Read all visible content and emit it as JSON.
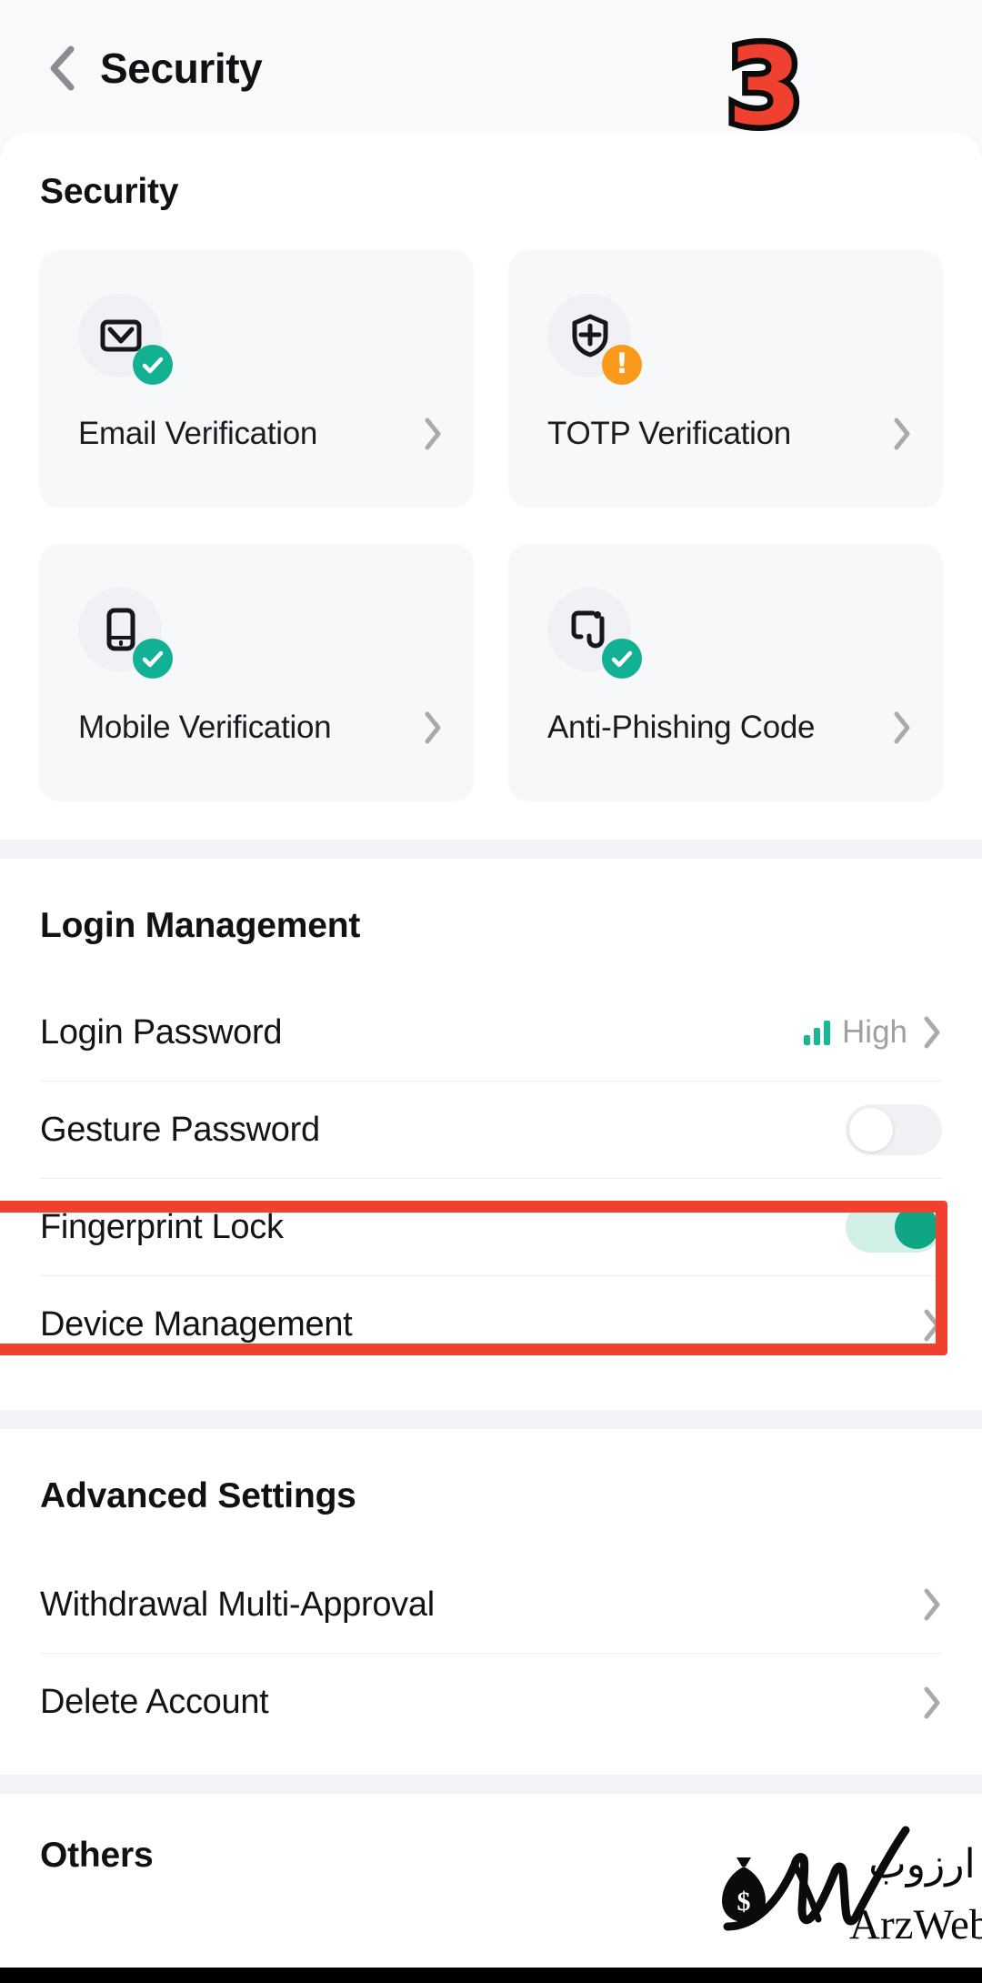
{
  "nav": {
    "back_icon": "chevron-left-icon",
    "title": "Security"
  },
  "annotation": {
    "step_number": "3",
    "step_fill_color": "#f0402f",
    "step_stroke_color": "#0b0b0b",
    "highlight_color": "#f2402e"
  },
  "security_section": {
    "title": "Security",
    "cards": [
      {
        "label": "Email Verification",
        "icon": "envelope-icon",
        "status": "verified",
        "badge_icon": "check-badge-icon",
        "badge_color": "#13b193",
        "chevron": "chevron-right-icon"
      },
      {
        "label": "TOTP Verification",
        "icon": "shield-plus-icon",
        "status": "warning",
        "badge_icon": "warning-badge-icon",
        "badge_color": "#f99a1c",
        "chevron": "chevron-right-icon"
      },
      {
        "label": "Mobile Verification",
        "icon": "mobile-phone-icon",
        "status": "verified",
        "badge_icon": "check-badge-icon",
        "badge_color": "#13b193",
        "chevron": "chevron-right-icon"
      },
      {
        "label": "Anti-Phishing Code",
        "icon": "fishing-hook-icon",
        "status": "verified",
        "badge_icon": "check-badge-icon",
        "badge_color": "#13b193",
        "chevron": "chevron-right-icon"
      }
    ]
  },
  "login_management": {
    "title": "Login Management",
    "rows": [
      {
        "label": "Login Password",
        "type": "value",
        "value": "High",
        "value_icon": "signal-bars-icon",
        "value_icon_color": "#17b894",
        "chevron": "chevron-right-icon"
      },
      {
        "label": "Gesture Password",
        "type": "toggle",
        "toggle_state": "off"
      },
      {
        "label": "Fingerprint Lock",
        "type": "toggle",
        "toggle_state": "on",
        "toggle_on_color": "#0fa683",
        "highlighted": true
      },
      {
        "label": "Device Management",
        "type": "link",
        "chevron": "chevron-right-icon"
      }
    ]
  },
  "advanced_settings": {
    "title": "Advanced Settings",
    "rows": [
      {
        "label": "Withdrawal Multi-Approval",
        "type": "link",
        "chevron": "chevron-right-icon"
      },
      {
        "label": "Delete Account",
        "type": "link",
        "chevron": "chevron-right-icon"
      }
    ]
  },
  "others_section": {
    "title": "Others"
  },
  "watermark": {
    "brand_latin": "ArzWeb",
    "brand_persian": "ارزوب",
    "icon": "money-bag-icon"
  }
}
